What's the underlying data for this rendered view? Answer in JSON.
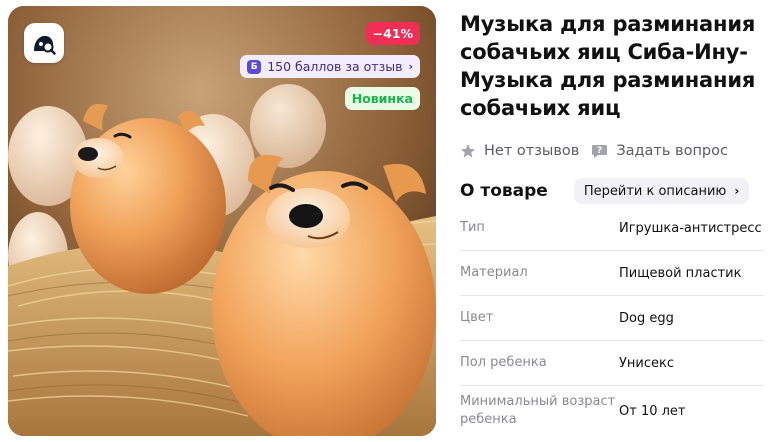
{
  "product": {
    "title": "Музыка для разминания собачьих яиц Сиба-Ину-Музыка для разминания собачьих яиц"
  },
  "photo": {
    "discount": "−41%",
    "bonus_icon": "Б",
    "bonus_text": "150 баллов за отзыв",
    "new_badge": "Новинка",
    "visual_search_icon": "visual-search-icon"
  },
  "meta": {
    "reviews": "Нет отзывов",
    "ask": "Задать вопрос"
  },
  "about": {
    "title": "О товаре",
    "goto_label": "Перейти к описанию"
  },
  "specs": [
    {
      "key": "Тип",
      "value": "Игрушка-антистресс"
    },
    {
      "key": "Материал",
      "value": "Пищевой пластик"
    },
    {
      "key": "Цвет",
      "value": "Dog egg"
    },
    {
      "key": "Пол ребенка",
      "value": "Унисекс"
    },
    {
      "key": "Минимальный возраст ребенка",
      "value": "От 10 лет"
    }
  ],
  "colors": {
    "discount_bg": "#f22e57",
    "bonus_bg": "#f2edff",
    "bonus_accent": "#5b4ad6",
    "new_bg": "#e8fbe7",
    "new_text": "#1bb34c"
  }
}
